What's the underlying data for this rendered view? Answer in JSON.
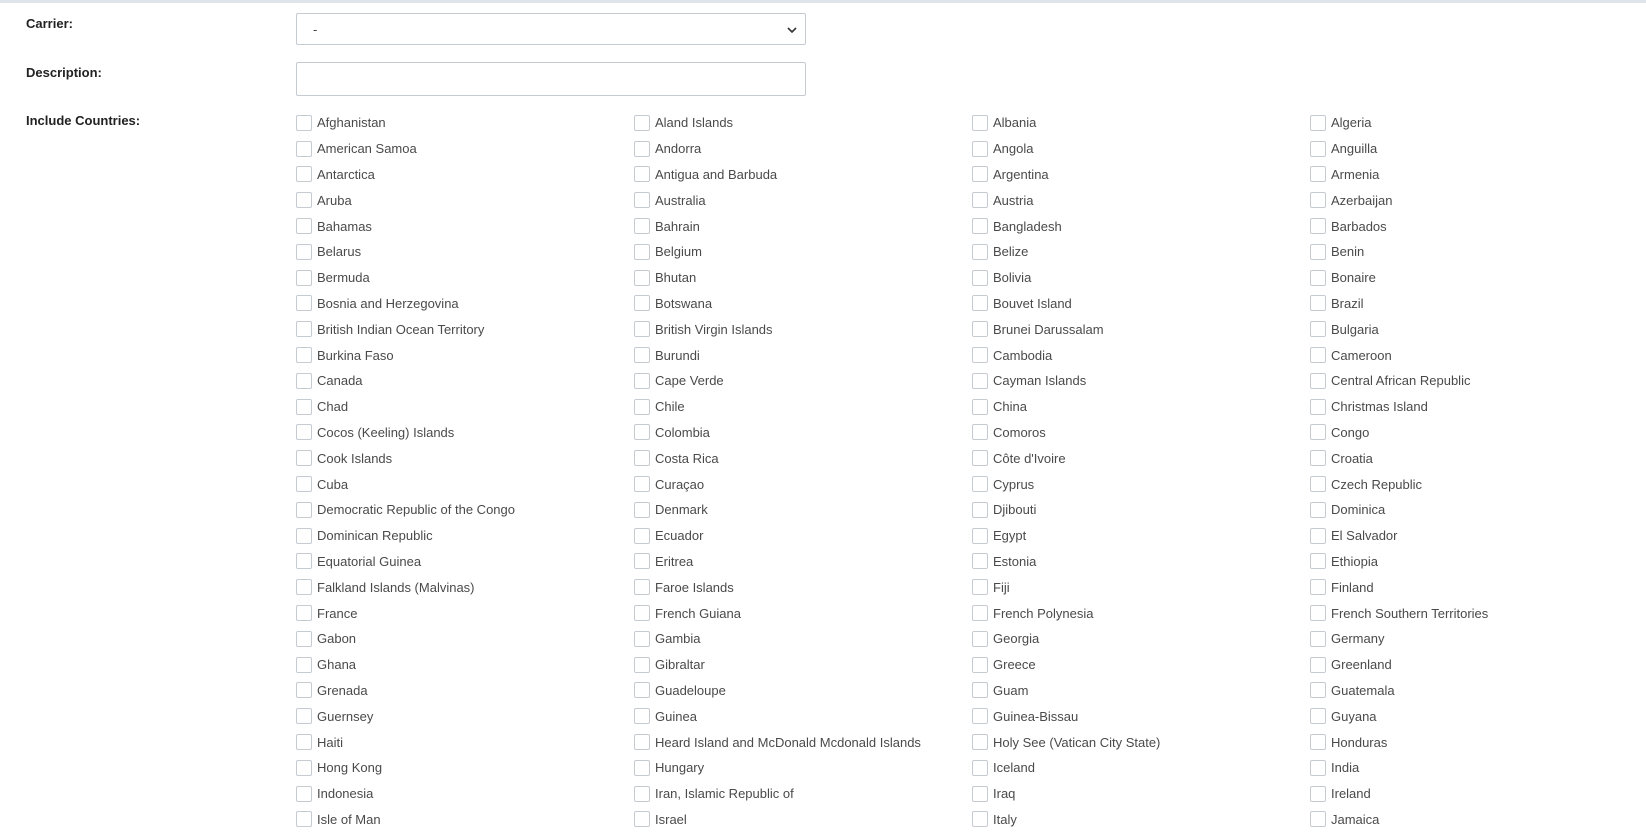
{
  "form": {
    "carrier": {
      "label": "Carrier:",
      "selected": "-"
    },
    "description": {
      "label": "Description:",
      "value": "",
      "placeholder": ""
    },
    "include_countries": {
      "label": "Include Countries:",
      "countries": [
        "Afghanistan",
        "Aland Islands",
        "Albania",
        "Algeria",
        "American Samoa",
        "Andorra",
        "Angola",
        "Anguilla",
        "Antarctica",
        "Antigua and Barbuda",
        "Argentina",
        "Armenia",
        "Aruba",
        "Australia",
        "Austria",
        "Azerbaijan",
        "Bahamas",
        "Bahrain",
        "Bangladesh",
        "Barbados",
        "Belarus",
        "Belgium",
        "Belize",
        "Benin",
        "Bermuda",
        "Bhutan",
        "Bolivia",
        "Bonaire",
        "Bosnia and Herzegovina",
        "Botswana",
        "Bouvet Island",
        "Brazil",
        "British Indian Ocean Territory",
        "British Virgin Islands",
        "Brunei Darussalam",
        "Bulgaria",
        "Burkina Faso",
        "Burundi",
        "Cambodia",
        "Cameroon",
        "Canada",
        "Cape Verde",
        "Cayman Islands",
        "Central African Republic",
        "Chad",
        "Chile",
        "China",
        "Christmas Island",
        "Cocos (Keeling) Islands",
        "Colombia",
        "Comoros",
        "Congo",
        "Cook Islands",
        "Costa Rica",
        "Côte d'Ivoire",
        "Croatia",
        "Cuba",
        "Curaçao",
        "Cyprus",
        "Czech Republic",
        "Democratic Republic of the Congo",
        "Denmark",
        "Djibouti",
        "Dominica",
        "Dominican Republic",
        "Ecuador",
        "Egypt",
        "El Salvador",
        "Equatorial Guinea",
        "Eritrea",
        "Estonia",
        "Ethiopia",
        "Falkland Islands (Malvinas)",
        "Faroe Islands",
        "Fiji",
        "Finland",
        "France",
        "French Guiana",
        "French Polynesia",
        "French Southern Territories",
        "Gabon",
        "Gambia",
        "Georgia",
        "Germany",
        "Ghana",
        "Gibraltar",
        "Greece",
        "Greenland",
        "Grenada",
        "Guadeloupe",
        "Guam",
        "Guatemala",
        "Guernsey",
        "Guinea",
        "Guinea-Bissau",
        "Guyana",
        "Haiti",
        "Heard Island and McDonald Mcdonald Islands",
        "Holy See (Vatican City State)",
        "Honduras",
        "Hong Kong",
        "Hungary",
        "Iceland",
        "India",
        "Indonesia",
        "Iran, Islamic Republic of",
        "Iraq",
        "Ireland",
        "Isle of Man",
        "Israel",
        "Italy",
        "Jamaica"
      ]
    }
  },
  "colors": {
    "border": "#c6cbd2",
    "top_bar": "#dfe3ea"
  },
  "icons": {
    "select_arrow": "chevron-down-icon"
  }
}
